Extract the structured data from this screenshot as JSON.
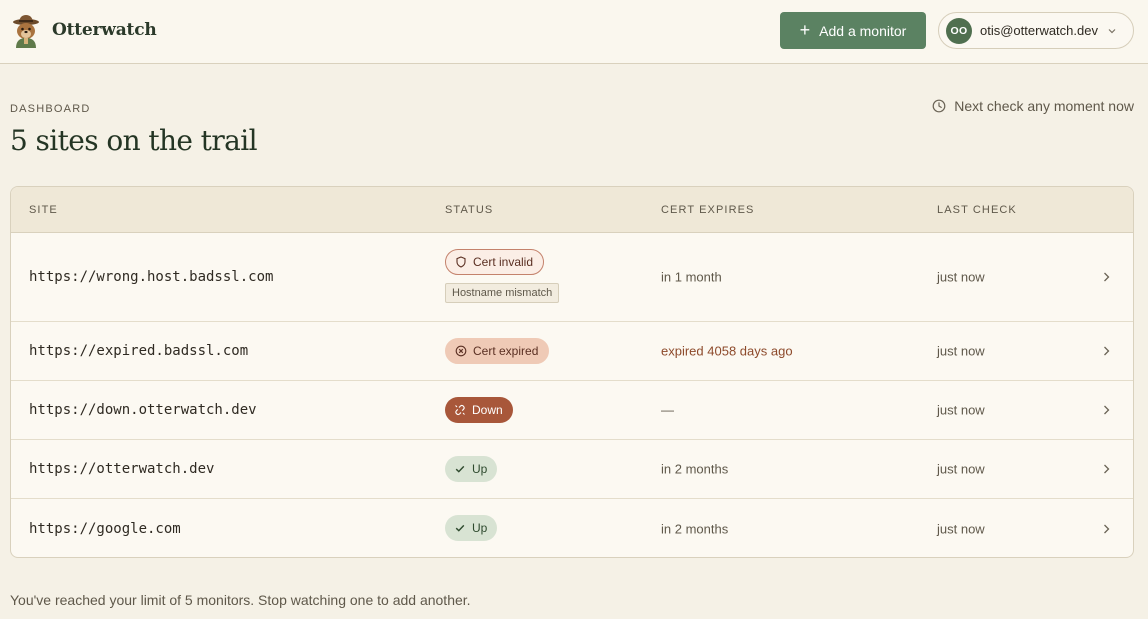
{
  "header": {
    "brand": "Otterwatch",
    "add_button_label": "Add a monitor",
    "user_initials": "OO",
    "user_email": "otis@otterwatch.dev"
  },
  "page": {
    "eyebrow": "DASHBOARD",
    "title": "5 sites on the trail",
    "next_check": "Next check any moment now"
  },
  "table": {
    "columns": [
      "SITE",
      "STATUS",
      "CERT EXPIRES",
      "LAST CHECK"
    ],
    "rows": [
      {
        "site": "https://wrong.host.badssl.com",
        "status": "Cert invalid",
        "status_icon": "shield-icon",
        "status_detail": "Hostname mismatch",
        "cert": "in 1 month",
        "last": "just now"
      },
      {
        "site": "https://expired.badssl.com",
        "status": "Cert expired",
        "status_icon": "x-circle-icon",
        "cert": "expired 4058 days ago",
        "last": "just now"
      },
      {
        "site": "https://down.otterwatch.dev",
        "status": "Down",
        "status_icon": "broken-link-icon",
        "cert": "—",
        "last": "just now"
      },
      {
        "site": "https://otterwatch.dev",
        "status": "Up",
        "status_icon": "check-icon",
        "cert": "in 2 months",
        "last": "just now"
      },
      {
        "site": "https://google.com",
        "status": "Up",
        "status_icon": "check-icon",
        "cert": "in 2 months",
        "last": "just now"
      }
    ]
  },
  "footer": {
    "limit_note": "You've reached your limit of 5 monitors. Stop watching one to add another."
  },
  "colors": {
    "accent": "#5b8262",
    "down": "#a8573a",
    "expired": "#efcab6",
    "up": "#d8e3d3",
    "background": "#f5f1e6"
  }
}
